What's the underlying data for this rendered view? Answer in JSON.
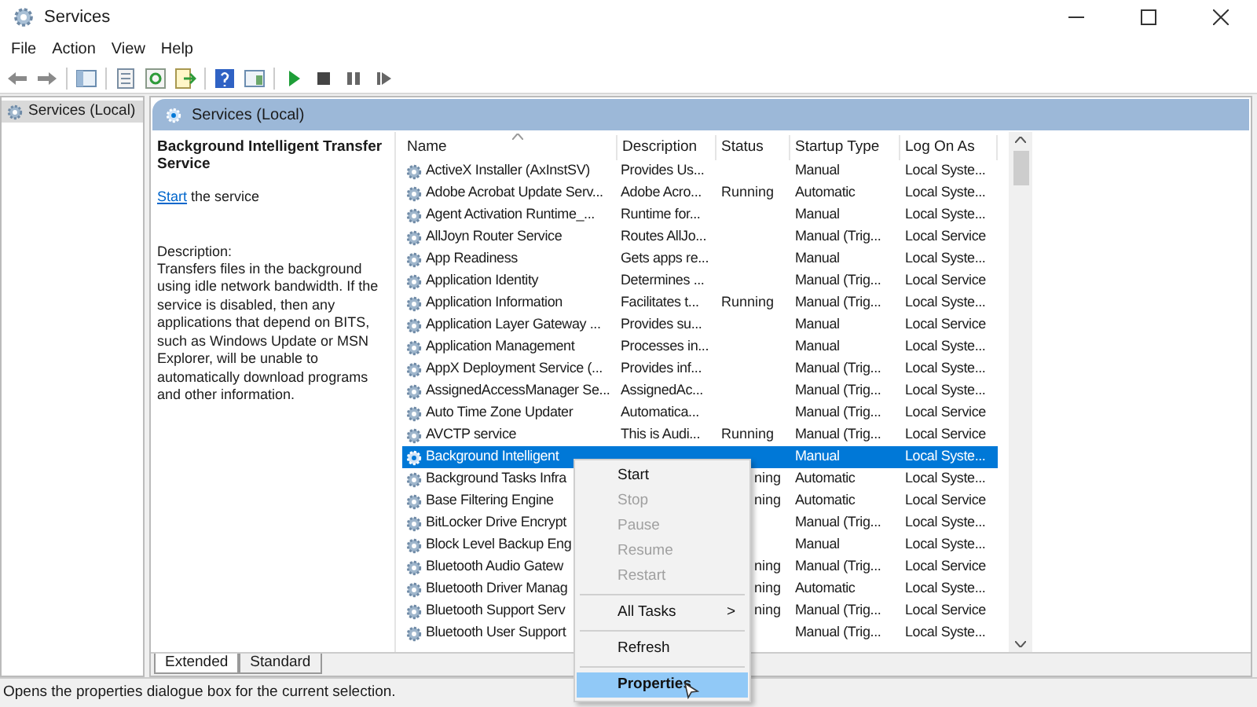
{
  "window": {
    "title": "Services"
  },
  "menu_bar": [
    "File",
    "Action",
    "View",
    "Help"
  ],
  "console_tree": {
    "items": [
      {
        "label": "Services (Local)",
        "selected": true
      }
    ]
  },
  "pane_header": {
    "title": "Services (Local)"
  },
  "details": {
    "title": "Background Intelligent Transfer Service",
    "action_link": "Start",
    "action_text": "the service",
    "description_label": "Description:",
    "description": "Transfers files in the background using idle network bandwidth. If the service is disabled, then any applications that depend on BITS, such as Windows Update or MSN Explorer, will be unable to automatically download programs and other information."
  },
  "table": {
    "columns": [
      "Name",
      "Description",
      "Status",
      "Startup Type",
      "Log On As"
    ],
    "rows": [
      {
        "name": "ActiveX Installer (AxInstSV)",
        "description": "Provides Us...",
        "startup_type": "Manual",
        "log_on_as": "Local Syste...",
        "selected": false
      },
      {
        "name": "Adobe Acrobat Update Serv...",
        "description": "Adobe Acro...",
        "status": "Running",
        "startup_type": "Automatic",
        "log_on_as": "Local Syste...",
        "selected": false
      },
      {
        "name": "Agent Activation Runtime_...",
        "description": "Runtime for...",
        "startup_type": "Manual",
        "log_on_as": "Local Syste...",
        "selected": false
      },
      {
        "name": "AllJoyn Router Service",
        "description": "Routes AllJo...",
        "startup_type": "Manual (Trig...",
        "log_on_as": "Local Service",
        "selected": false
      },
      {
        "name": "App Readiness",
        "description": "Gets apps re...",
        "startup_type": "Manual",
        "log_on_as": "Local Syste...",
        "selected": false
      },
      {
        "name": "Application Identity",
        "description": "Determines ...",
        "startup_type": "Manual (Trig...",
        "log_on_as": "Local Service",
        "selected": false
      },
      {
        "name": "Application Information",
        "description": "Facilitates t...",
        "status": "Running",
        "startup_type": "Manual (Trig...",
        "log_on_as": "Local Syste...",
        "selected": false
      },
      {
        "name": "Application Layer Gateway ...",
        "description": "Provides su...",
        "startup_type": "Manual",
        "log_on_as": "Local Service",
        "selected": false
      },
      {
        "name": "Application Management",
        "description": "Processes in...",
        "startup_type": "Manual",
        "log_on_as": "Local Syste...",
        "selected": false
      },
      {
        "name": "AppX Deployment Service (...",
        "description": "Provides inf...",
        "startup_type": "Manual (Trig...",
        "log_on_as": "Local Syste...",
        "selected": false
      },
      {
        "name": "AssignedAccessManager Se...",
        "description": "AssignedAc...",
        "startup_type": "Manual (Trig...",
        "log_on_as": "Local Syste...",
        "selected": false
      },
      {
        "name": "Auto Time Zone Updater",
        "description": "Automatica...",
        "startup_type": "Manual (Trig...",
        "log_on_as": "Local Service",
        "selected": false
      },
      {
        "name": "AVCTP service",
        "description": "This is Audi...",
        "status": "Running",
        "startup_type": "Manual (Trig...",
        "log_on_as": "Local Service",
        "selected": false
      },
      {
        "name": "Background Intelligent",
        "startup_type": "Manual",
        "log_on_as": "Local Syste...",
        "selected": true
      },
      {
        "name": "Background Tasks Infra",
        "status": "ning",
        "startup_type": "Automatic",
        "log_on_as": "Local Syste...",
        "selected": false
      },
      {
        "name": "Base Filtering Engine",
        "status": "ning",
        "startup_type": "Automatic",
        "log_on_as": "Local Service",
        "selected": false
      },
      {
        "name": "BitLocker Drive Encrypt",
        "startup_type": "Manual (Trig...",
        "log_on_as": "Local Syste...",
        "selected": false
      },
      {
        "name": "Block Level Backup Eng",
        "startup_type": "Manual",
        "log_on_as": "Local Syste...",
        "selected": false
      },
      {
        "name": "Bluetooth Audio Gatew",
        "status": "ning",
        "startup_type": "Manual (Trig...",
        "log_on_as": "Local Service",
        "selected": false
      },
      {
        "name": "Bluetooth Driver Manag",
        "status": "ning",
        "startup_type": "Automatic",
        "log_on_as": "Local Syste...",
        "selected": false
      },
      {
        "name": "Bluetooth Support Serv",
        "status": "ning",
        "startup_type": "Manual (Trig...",
        "log_on_as": "Local Service",
        "selected": false
      },
      {
        "name": "Bluetooth User Support",
        "startup_type": "Manual (Trig...",
        "log_on_as": "Local Syste...",
        "selected": false
      }
    ]
  },
  "view_tabs": [
    {
      "label": "Extended",
      "selected": true
    },
    {
      "label": "Standard",
      "selected": false
    }
  ],
  "context_menu": {
    "items": [
      {
        "kind": "item",
        "label": "Start",
        "disabled": false,
        "highlighted": false
      },
      {
        "kind": "item",
        "label": "Stop",
        "disabled": true,
        "highlighted": false
      },
      {
        "kind": "item",
        "label": "Pause",
        "disabled": true,
        "highlighted": false
      },
      {
        "kind": "item",
        "label": "Resume",
        "disabled": true,
        "highlighted": false
      },
      {
        "kind": "item",
        "label": "Restart",
        "disabled": true,
        "highlighted": false
      },
      {
        "kind": "separator"
      },
      {
        "kind": "submenu",
        "label": "All Tasks",
        "arrow": ">",
        "disabled": false,
        "highlighted": false
      },
      {
        "kind": "separator"
      },
      {
        "kind": "item",
        "label": "Refresh",
        "disabled": false,
        "highlighted": false
      },
      {
        "kind": "separator"
      },
      {
        "kind": "default",
        "label": "Properties",
        "disabled": false,
        "highlighted": true
      }
    ]
  },
  "status_bar": {
    "text": "Opens the properties dialogue box for the current selection."
  }
}
